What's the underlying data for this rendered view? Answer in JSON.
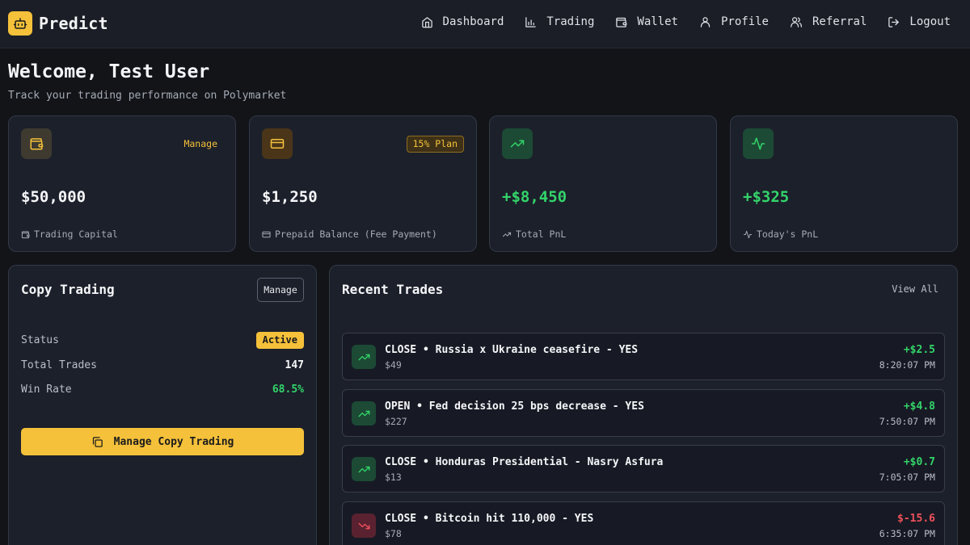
{
  "brand": {
    "name": "Predict",
    "logo_icon": "robot-icon"
  },
  "nav": [
    {
      "label": "Dashboard",
      "icon": "home-icon"
    },
    {
      "label": "Trading",
      "icon": "bar-chart-icon"
    },
    {
      "label": "Wallet",
      "icon": "wallet-icon"
    },
    {
      "label": "Profile",
      "icon": "user-icon"
    },
    {
      "label": "Referral",
      "icon": "users-icon"
    },
    {
      "label": "Logout",
      "icon": "logout-icon"
    }
  ],
  "header": {
    "welcome": "Welcome, Test User",
    "subtitle": "Track your trading performance on Polymarket"
  },
  "stats": [
    {
      "value": "$50,000",
      "label": "Trading Capital",
      "icon": "wallet-icon",
      "action": "Manage"
    },
    {
      "value": "$1,250",
      "label": "Prepaid Balance (Fee Payment)",
      "icon": "credit-card-icon",
      "badge": "15% Plan"
    },
    {
      "value": "+$8,450",
      "label": "Total PnL",
      "icon": "trending-up-icon"
    },
    {
      "value": "+$325",
      "label": "Today's PnL",
      "icon": "activity-icon"
    }
  ],
  "copy_trading": {
    "title": "Copy Trading",
    "manage_label": "Manage",
    "status_label": "Status",
    "status_value": "Active",
    "trades_label": "Total Trades",
    "trades_value": "147",
    "winrate_label": "Win Rate",
    "winrate_value": "68.5%",
    "button_label": "Manage Copy Trading",
    "button_icon": "copy-icon"
  },
  "recent_trades": {
    "title": "Recent Trades",
    "view_all": "View All",
    "rows": [
      {
        "title": "CLOSE • Russia x Ukraine ceasefire - YES",
        "amount": "$49",
        "pnl": "+$2.5",
        "time": "8:20:07 PM",
        "direction": "up"
      },
      {
        "title": "OPEN • Fed decision 25 bps decrease - YES",
        "amount": "$227",
        "pnl": "+$4.8",
        "time": "7:50:07 PM",
        "direction": "up"
      },
      {
        "title": "CLOSE • Honduras Presidential - Nasry Asfura",
        "amount": "$13",
        "pnl": "+$0.7",
        "time": "7:05:07 PM",
        "direction": "up"
      },
      {
        "title": "CLOSE • Bitcoin hit 110,000 - YES",
        "amount": "$78",
        "pnl": "$-15.6",
        "time": "6:35:07 PM",
        "direction": "down"
      }
    ]
  },
  "colors": {
    "accent": "#f5c13a",
    "positive": "#33d46a",
    "negative": "#f0505a",
    "background": "#121418",
    "card": "#1c202b"
  }
}
